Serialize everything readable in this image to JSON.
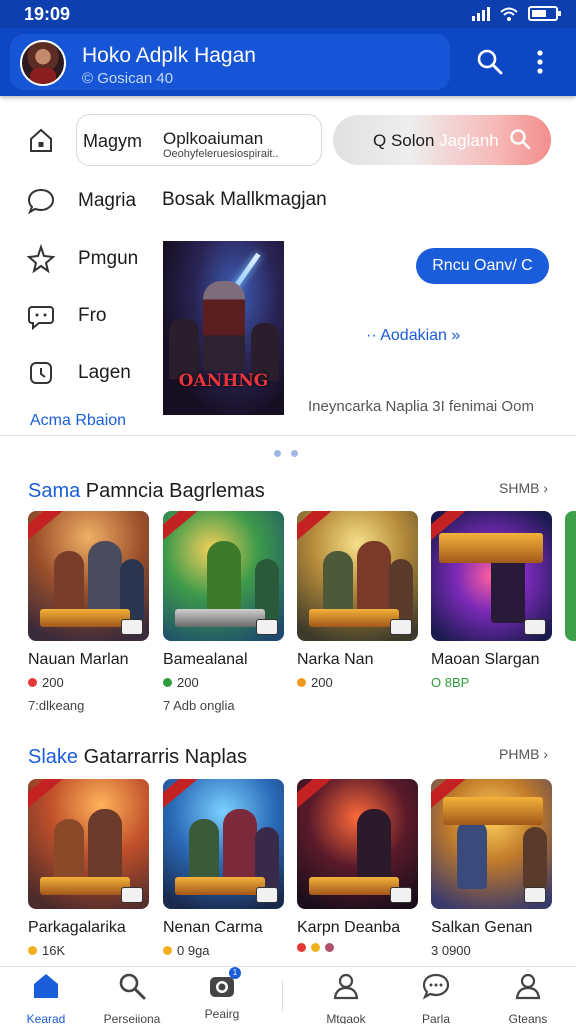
{
  "status_bar": {
    "time": "19:09"
  },
  "header": {
    "name": "Hoko Adplk Hagan",
    "subtitle": "Gosican 40"
  },
  "sidebar": {
    "items": [
      {
        "label": "Magym",
        "icon": "home-icon"
      },
      {
        "label": "Magria",
        "icon": "chat-bubble-icon"
      },
      {
        "label": "Pmgun",
        "icon": "star-icon"
      },
      {
        "label": "Fro",
        "icon": "message-icon"
      },
      {
        "label": "Lagen",
        "icon": "clock-icon"
      }
    ],
    "more_link": "Acma Rbaion"
  },
  "field": {
    "title": "Oplkoaiuman",
    "subtitle": "Oeohyfeleruesiospirait.."
  },
  "search": {
    "text": "Q Solon",
    "highlight": "Jaglanh"
  },
  "section_heading": "Bosak Mallkmagjan",
  "poster": {
    "title": "OANHNG"
  },
  "promo": {
    "button_label": "Rncu Oanv/ C",
    "link_label": "·· Aodakian »",
    "caption": "Ineyncarka Naplia 3I fenimai Oom"
  },
  "section1": {
    "title_accent": "Sama",
    "title_rest": " Pamncia Bagrlemas",
    "more": "SHMB ›",
    "games": [
      {
        "name": "Nauan Marlan",
        "meta": "200",
        "dot": "#e53935",
        "extra": "7:dlkeang"
      },
      {
        "name": "Bamealanal",
        "meta": "200",
        "dot": "#2e9c3a",
        "extra": "7 Adb onglia"
      },
      {
        "name": "Narka Nan",
        "meta": "200",
        "dot": "#f29a1f",
        "extra": ""
      },
      {
        "name": "Maoan Slargan",
        "meta": "O 8BP",
        "dot": "",
        "extra": ""
      }
    ]
  },
  "section2": {
    "title_accent": "Slake",
    "title_rest": " Gatarrarris Naplas",
    "more": "PHMB ›",
    "games": [
      {
        "name": "Parkagalarika",
        "meta": "16K",
        "dot": "#f2b01f",
        "extra": ""
      },
      {
        "name": "Nenan Carma",
        "meta": "0 9ga",
        "dot": "#f2b01f",
        "extra": ""
      },
      {
        "name": "Karpn Deanba",
        "meta": "",
        "dot": "multi",
        "extra": ""
      },
      {
        "name": "Salkan Genan",
        "meta": "3 0900",
        "dot": "",
        "extra": ""
      }
    ]
  },
  "bottom_nav": [
    {
      "label": "Kearad",
      "icon": "home-icon"
    },
    {
      "label": "Perseiiona",
      "icon": "search-icon"
    },
    {
      "label": "Peairg",
      "icon": "camera-icon",
      "badge": "1"
    },
    {
      "label": "Mtqaok",
      "icon": "user-heart-icon"
    },
    {
      "label": "Parla",
      "icon": "chat-icon"
    },
    {
      "label": "Gteans",
      "icon": "profile-icon"
    }
  ],
  "colors": {
    "brand": "#0e47c4",
    "accent": "#1a5ddb"
  }
}
